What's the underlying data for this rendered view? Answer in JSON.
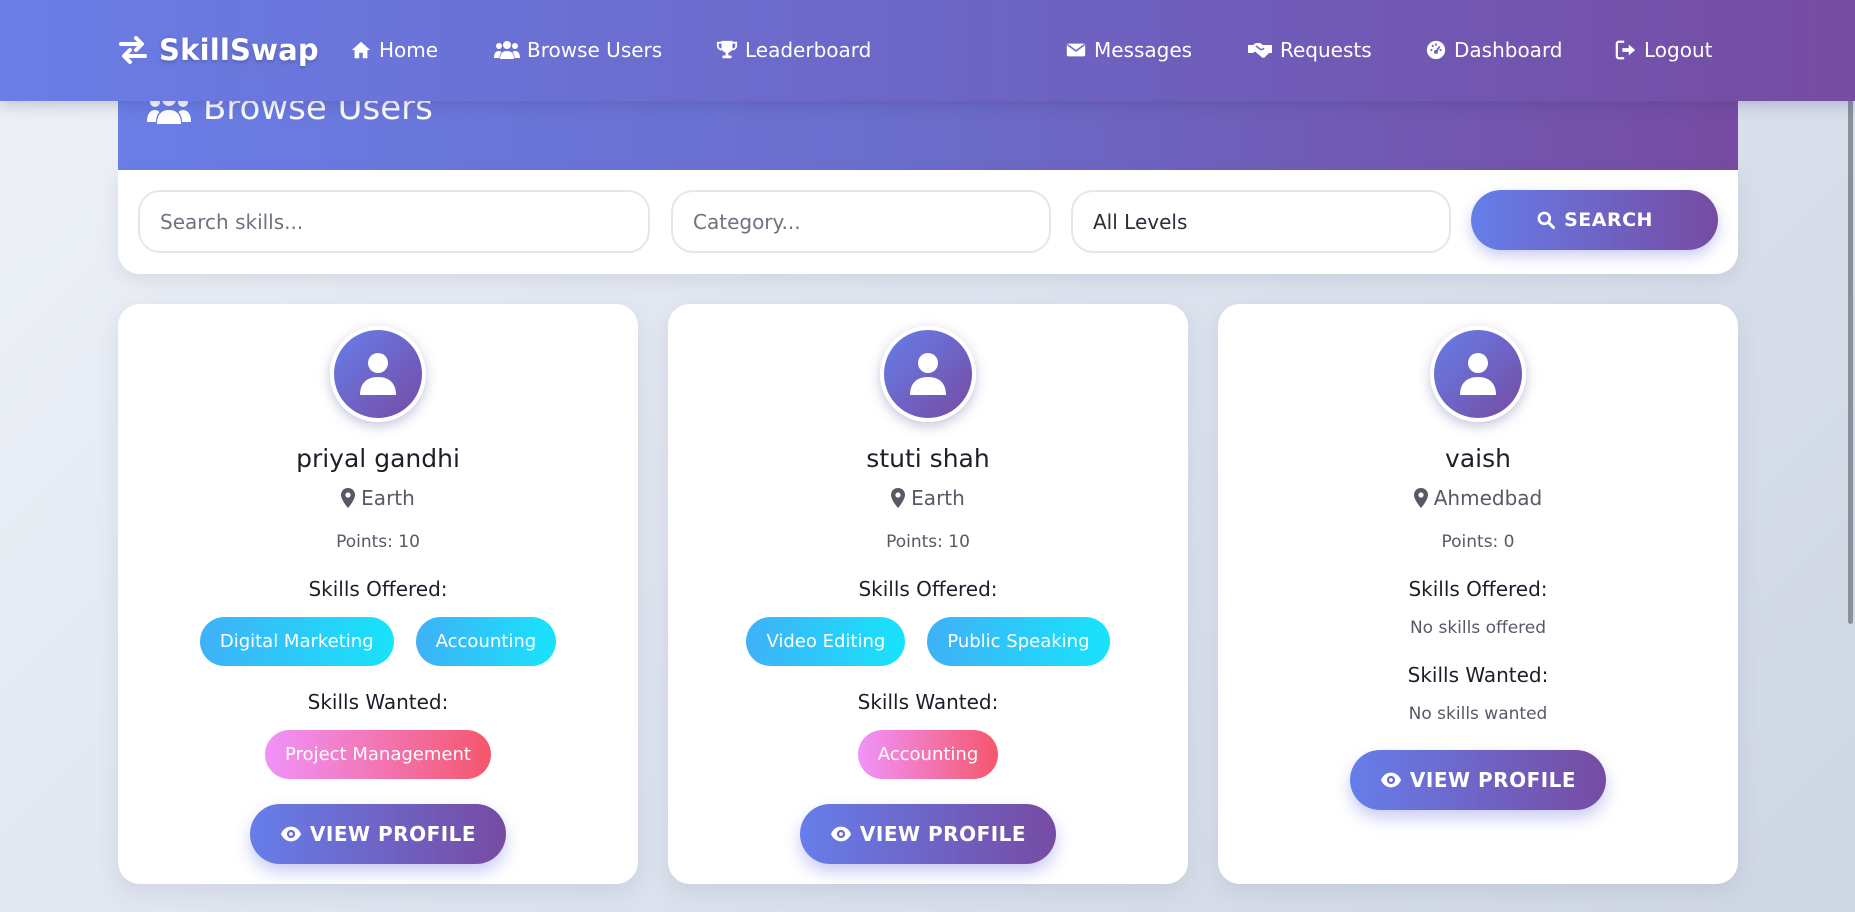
{
  "nav": {
    "brand": "SkillSwap",
    "left": [
      {
        "label": "Home",
        "icon": "home-icon"
      },
      {
        "label": "Browse Users",
        "icon": "users-icon"
      },
      {
        "label": "Leaderboard",
        "icon": "trophy-icon"
      }
    ],
    "right": [
      {
        "label": "Messages",
        "icon": "envelope-icon"
      },
      {
        "label": "Requests",
        "icon": "handshake-icon"
      },
      {
        "label": "Dashboard",
        "icon": "dashboard-icon"
      },
      {
        "label": "Logout",
        "icon": "logout-icon"
      }
    ]
  },
  "page": {
    "title": "Browse Users"
  },
  "search": {
    "skills_placeholder": "Search skills...",
    "category_placeholder": "Category...",
    "level_selected": "All Levels",
    "button_label": "SEARCH"
  },
  "labels": {
    "skills_offered": "Skills Offered:",
    "skills_wanted": "Skills Wanted:",
    "view_profile": "VIEW PROFILE"
  },
  "users": [
    {
      "name": "priyal gandhi",
      "location": "Earth",
      "points": "Points: 10",
      "offered": [
        "Digital Marketing",
        "Accounting"
      ],
      "wanted": [
        "Project Management"
      ]
    },
    {
      "name": "stuti shah",
      "location": "Earth",
      "points": "Points: 10",
      "offered": [
        "Video Editing",
        "Public Speaking"
      ],
      "wanted": [
        "Accounting"
      ]
    },
    {
      "name": "vaish",
      "location": "Ahmedbad",
      "points": "Points: 0",
      "offered_empty": "No skills offered",
      "wanted_empty": "No skills wanted"
    }
  ],
  "colors": {
    "primary_gradient_start": "#667eea",
    "primary_gradient_end": "#764ba2",
    "offered_tag": "#3fb1f7",
    "wanted_tag": "#f5576c"
  }
}
